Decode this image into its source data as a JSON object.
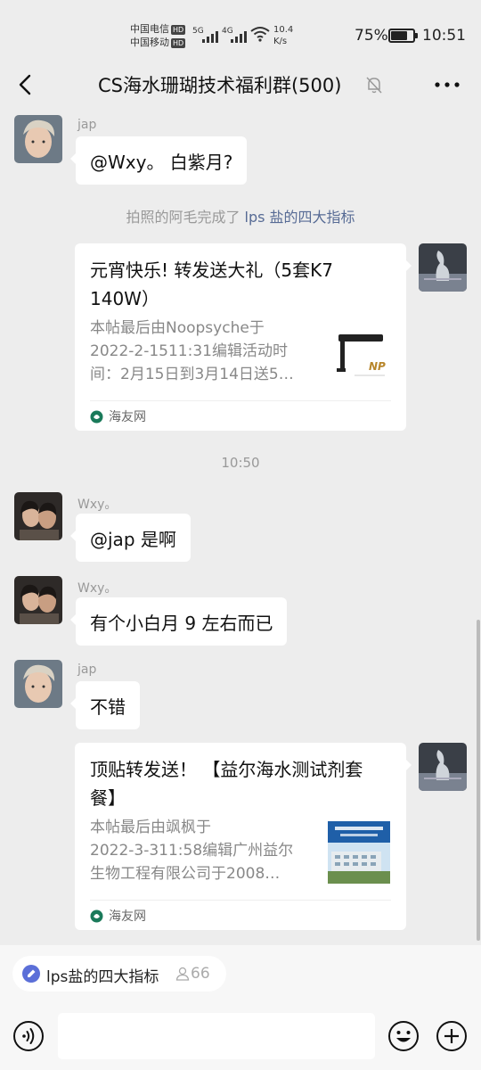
{
  "status": {
    "carrier1": "中国电信",
    "carrier2": "中国移动",
    "hd": "HD",
    "sig1_type": "5G",
    "sig2_type": "4G",
    "speed_value": "10.4",
    "speed_unit": "K/s",
    "battery_pct": "75%",
    "battery_level": 0.75,
    "time": "10:51"
  },
  "nav": {
    "title": "CS海水珊瑚技术福利群(500)"
  },
  "messages": [
    {
      "sender": "jap",
      "text": "@Wxy。 白紫月?"
    },
    {
      "system_prefix": "拍照的阿毛完成了 ",
      "system_link": "lps 盐的四大指标"
    },
    {
      "card_title": "元宵快乐! 转发送大礼（5套K7 140W）",
      "card_desc": [
        "本帖最后由Noopsyche于",
        "2022-2-1511:31编辑活动时",
        "间：2月15日到3月14日送5…"
      ],
      "card_source": "海友网",
      "thumb_brand": "NP"
    },
    {
      "time": "10:50"
    },
    {
      "sender": "Wxy。",
      "text": "@jap 是啊"
    },
    {
      "sender": "Wxy。",
      "text": "有个小白月 9 左右而已"
    },
    {
      "sender": "jap",
      "text": "不错"
    },
    {
      "card_title": "顶贴转发送！ 【益尔海水测试剂套餐】",
      "card_desc": [
        "本帖最后由飒枫于",
        "2022-3-311:58编辑广州益尔",
        "生物工程有限公司于2008…"
      ],
      "card_source": "海友网"
    }
  ],
  "quote_chip": {
    "label": "lps盐的四大指标",
    "count": "66"
  },
  "colors": {
    "background": "#ededed",
    "bubble": "#ffffff",
    "link": "#576b95",
    "meta_gray": "#999999"
  },
  "icons": [
    "back-arrow-icon",
    "mute-bell-icon",
    "more-dots-icon",
    "voice-icon",
    "emoji-icon",
    "plus-icon",
    "website-logo-icon",
    "people-icon"
  ]
}
